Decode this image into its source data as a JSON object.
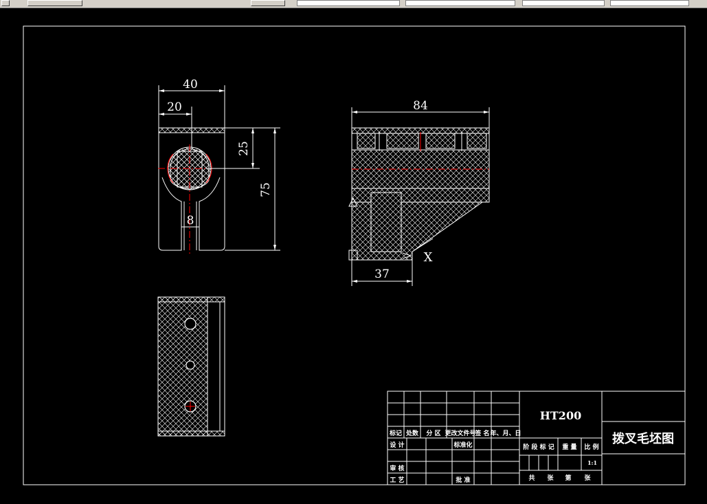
{
  "dimensions": {
    "front_width": "40",
    "front_half_width": "20",
    "front_bore_offset": "25",
    "front_height": "75",
    "slot_width": "8",
    "side_length": "84",
    "side_base": "37"
  },
  "misc": {
    "section_mark": "X"
  },
  "title_block": {
    "material": "HT200",
    "drawing_name": "拨叉毛坯图",
    "scale_value": "1:1",
    "rev_headers": [
      "标记",
      "处数",
      "分 区",
      "更改文件号",
      "签 名",
      "年、月、日"
    ],
    "design_label": "设 计",
    "standardize_label": "标准化",
    "review_label": "审 核",
    "process_label": "工 艺",
    "approve_label": "批 准",
    "stage_label": "阶 段 标 记",
    "weight_label": "重 量",
    "scale_label": "比 例",
    "sheet_total_label": "共",
    "sheet_unit_label": "张",
    "sheet_no_label": "第",
    "sheet_unit2_label": "张"
  },
  "colors": {
    "background": "#000000",
    "line": "#ffffff",
    "centerline": "#ff0000"
  }
}
